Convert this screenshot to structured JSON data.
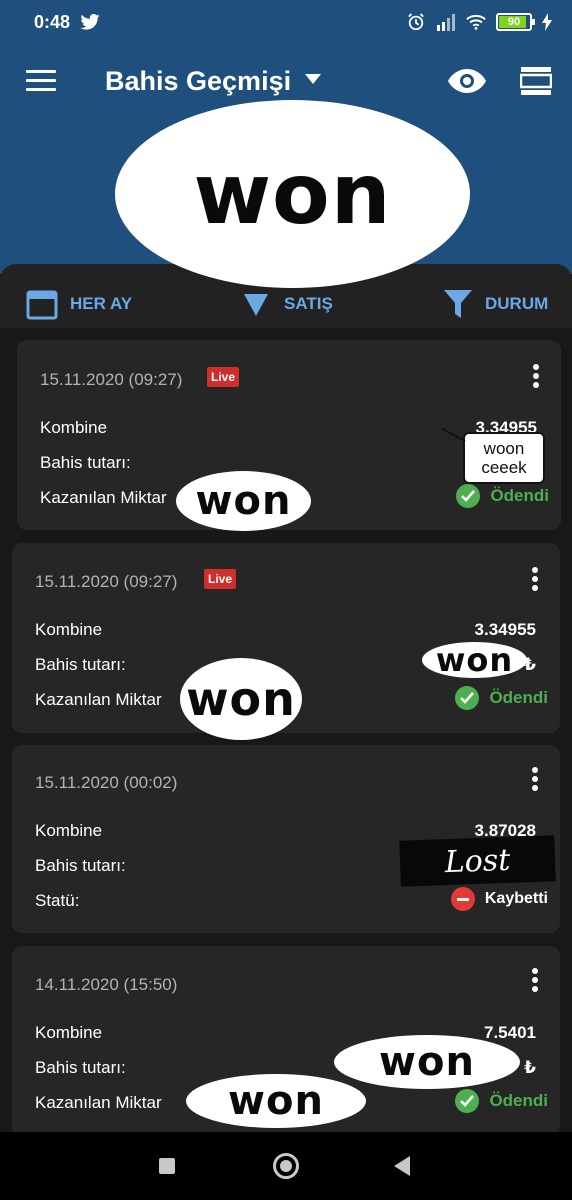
{
  "status_bar": {
    "time": "0:48",
    "battery": "90",
    "battery_level": 0.9
  },
  "app_bar": {
    "title": "Bahis Geçmişi"
  },
  "filters": {
    "month": "HER AY",
    "sort": "SATIŞ",
    "status": "DURUM"
  },
  "stickers": {
    "main": "won",
    "bubble": "woon ceeek",
    "lost": "Lost"
  },
  "bets": [
    {
      "date": "15.11.2020 (09:27)",
      "live": "Live",
      "rows": [
        {
          "label": "Kombine",
          "value": "3.34955"
        },
        {
          "label": "Bahis tutarı:",
          "value": ""
        },
        {
          "label": "Kazanılan Miktar",
          "value": ""
        }
      ],
      "status": "Ödendi",
      "sticker": "won"
    },
    {
      "date": "15.11.2020 (09:27)",
      "live": "Live",
      "rows": [
        {
          "label": "Kombine",
          "value": "3.34955"
        },
        {
          "label": "Bahis tutarı:",
          "value": "₺"
        },
        {
          "label": "Kazanılan Miktar",
          "value": ""
        }
      ],
      "status": "Ödendi",
      "sticker_amount": "won",
      "sticker_payout": "won"
    },
    {
      "date": "15.11.2020 (00:02)",
      "rows": [
        {
          "label": "Kombine",
          "value": "3.87028"
        },
        {
          "label": "Bahis tutarı:",
          "value": ""
        },
        {
          "label": "Statü:",
          "value": ""
        }
      ],
      "status": "Kaybetti"
    },
    {
      "date": "14.11.2020 (15:50)",
      "rows": [
        {
          "label": "Kombine",
          "value": "7.5401"
        },
        {
          "label": "Bahis tutarı:",
          "value": "₺"
        },
        {
          "label": "Kazanılan Miktar",
          "value": ""
        }
      ],
      "status": "Ödendi",
      "sticker_amount": "won",
      "sticker_payout": "won"
    }
  ],
  "colors": {
    "header": "#1f4f7d",
    "accent": "#6aa8e8",
    "paid": "#4caf50",
    "lost": "#e53935",
    "live": "#d22d2d"
  }
}
